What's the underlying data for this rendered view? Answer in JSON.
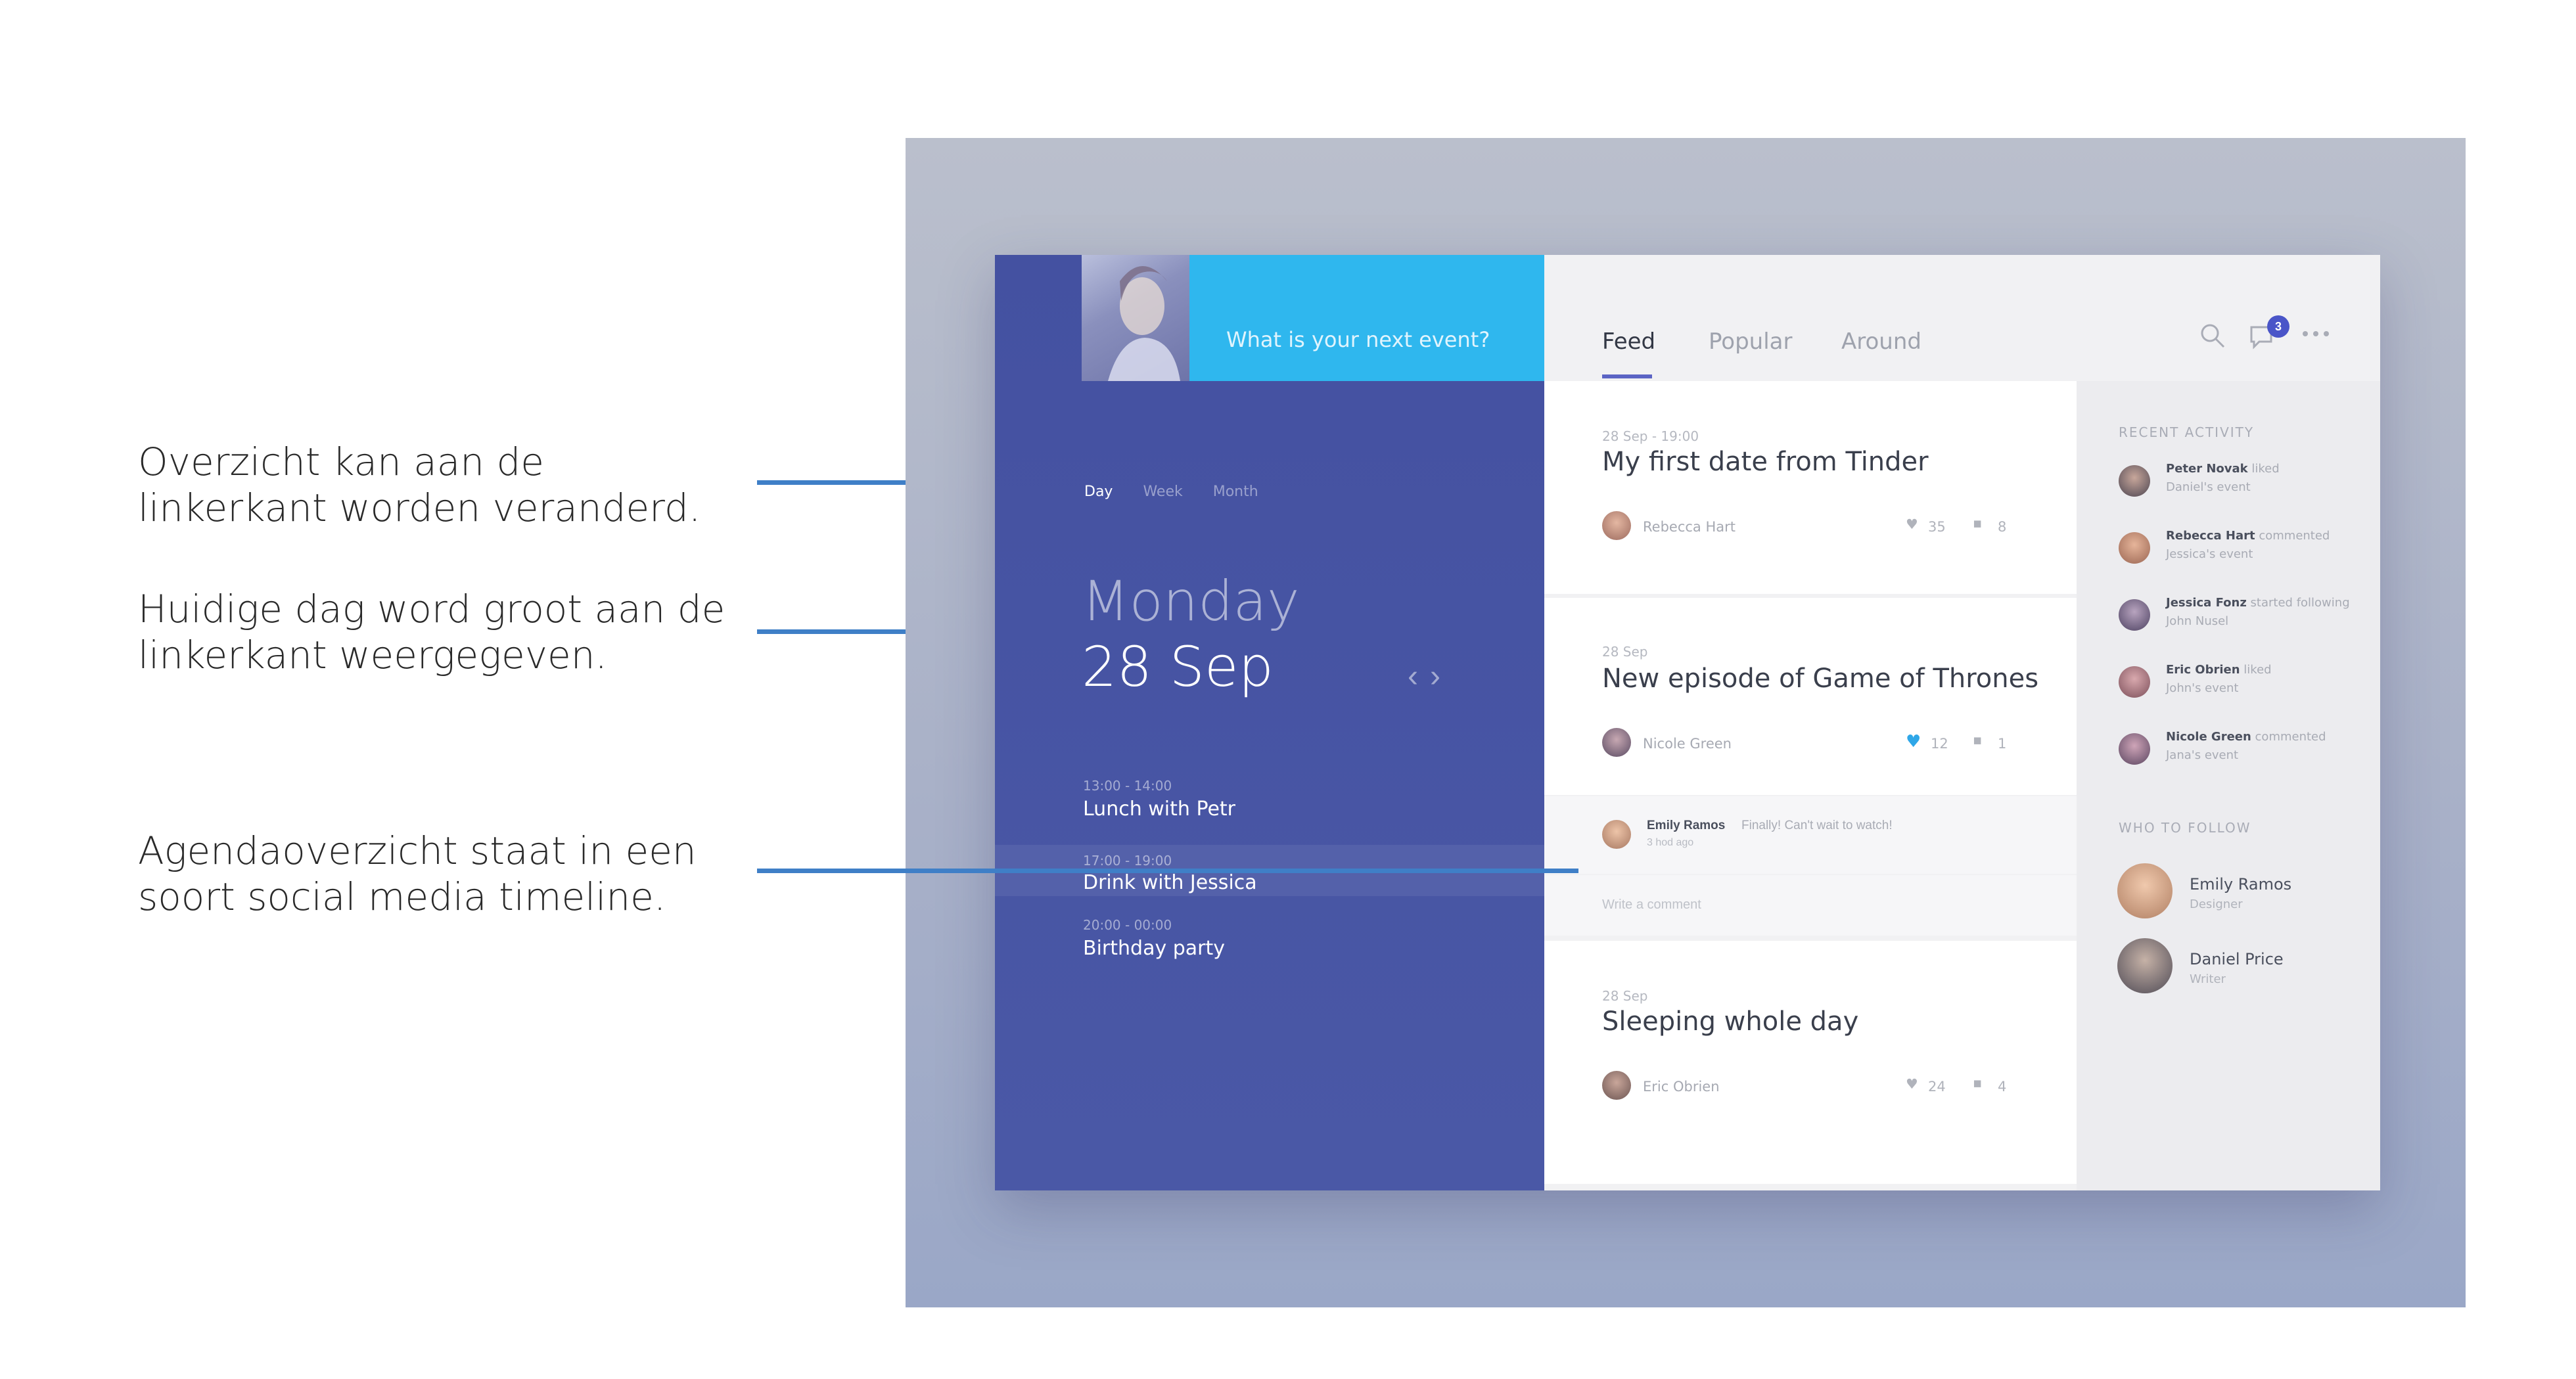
{
  "annotations": {
    "a1": "Overzicht kan aan de linkerkant worden veranderd.",
    "a2": "Huidige dag word groot aan de linkerkant weergegeven.",
    "a3": "Agendaoverzicht staat in een soort social media timeline."
  },
  "left_panel": {
    "event_placeholder": "What is your next event?",
    "view_tabs": [
      "Day",
      "Week",
      "Month"
    ],
    "day_name": "Monday",
    "date": "28 Sep",
    "agenda": [
      {
        "time": "13:00 - 14:00",
        "title": "Lunch with Petr"
      },
      {
        "time": "17:00 - 19:00",
        "title": "Drink with Jessica"
      },
      {
        "time": "20:00 - 00:00",
        "title": "Birthday party"
      }
    ]
  },
  "topbar": {
    "tabs": [
      "Feed",
      "Popular",
      "Around"
    ],
    "notification_count": "3"
  },
  "feed": {
    "cards": [
      {
        "time": "28 Sep - 19:00",
        "title": "My first date from Tinder",
        "author": "Rebecca Hart",
        "likes": "35",
        "comments": "8"
      },
      {
        "time": "28 Sep",
        "title": "New episode of Game of Thrones",
        "author": "Nicole Green",
        "likes": "12",
        "comments": "1"
      },
      {
        "time": "28 Sep",
        "title": "Sleeping whole day",
        "author": "Eric Obrien",
        "likes": "24",
        "comments": "4"
      }
    ],
    "comment": {
      "author": "Emily Ramos",
      "text": "Finally! Can't wait to watch!",
      "ago": "3 hod ago"
    },
    "comment_placeholder": "Write a comment"
  },
  "sidebar": {
    "recent_heading": "RECENT ACTIVITY",
    "activity": [
      {
        "name": "Peter Novak",
        "action": "liked",
        "target": "Daniel's event"
      },
      {
        "name": "Rebecca Hart",
        "action": "commented",
        "target": "Jessica's event"
      },
      {
        "name": "Jessica Fonz",
        "action": "started following",
        "target": "John Nusel"
      },
      {
        "name": "Eric Obrien",
        "action": "liked",
        "target": "John's event"
      },
      {
        "name": "Nicole Green",
        "action": "commented",
        "target": "Jana's event"
      }
    ],
    "follow_heading": "WHO TO FOLLOW",
    "follow": [
      {
        "name": "Emily Ramos",
        "role": "Designer"
      },
      {
        "name": "Daniel Price",
        "role": "Writer"
      }
    ]
  },
  "colors": {
    "left_panel": "#4451a1",
    "event_bar": "#2fb7ee",
    "accent": "#5b64c4",
    "leader_line": "#3f7fc7",
    "like_active": "#2fa7e8"
  }
}
